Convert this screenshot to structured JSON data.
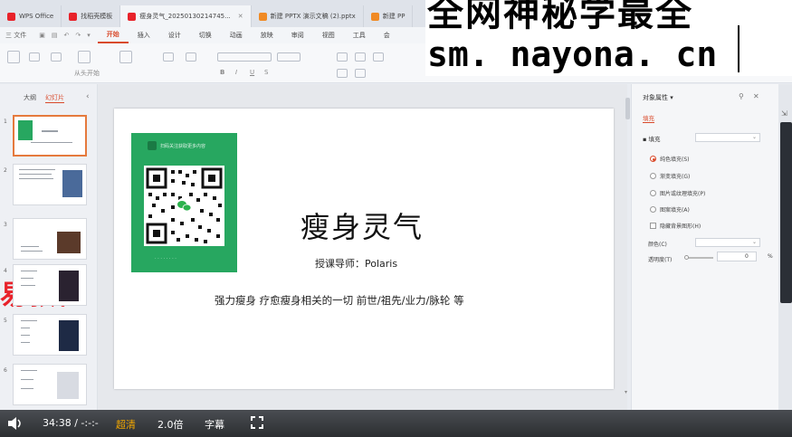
{
  "tabs": [
    {
      "label": "WPS Office",
      "color": "#e8222a"
    },
    {
      "label": "找稻壳模板",
      "color": "#e8222a"
    },
    {
      "label": "瘦身灵气_20250130214745...",
      "color": "#e8222a"
    },
    {
      "label": "新建 PPTX 演示文稿 (2).pptx",
      "color": "#f08a24"
    },
    {
      "label": "新建 PP",
      "color": "#f08a24"
    }
  ],
  "menu": {
    "file": "三 文件",
    "items": [
      "开始",
      "插入",
      "设计",
      "切换",
      "动画",
      "放映",
      "审阅",
      "视图",
      "工具",
      "会"
    ],
    "active": "开始"
  },
  "ribbon": {
    "play_from_start": "从头开始"
  },
  "overlay": {
    "line1": "全网神秘学最全",
    "line2": "sm. nayona. cn"
  },
  "left_panel": {
    "tab_outline": "大纲",
    "tab_slides": "幻灯片",
    "slide_numbers": [
      "1",
      "2",
      "3",
      "4",
      "5",
      "6"
    ],
    "promo_text": "易教程"
  },
  "slide": {
    "qr_caption": "扫码关注获取更多内容",
    "title": "瘦身灵气",
    "teacher": "授课导师：Polaris",
    "description": "强力瘦身 疗愈瘦身相关的一切 前世/祖先/业力/脉轮 等"
  },
  "properties": {
    "title": "对象属性 ▾",
    "tab": "填充",
    "section": "▪ 填充",
    "options": [
      {
        "label": "纯色填充(S)",
        "selected": true
      },
      {
        "label": "渐变填充(G)",
        "selected": false
      },
      {
        "label": "图片或纹理填充(P)",
        "selected": false
      },
      {
        "label": "图案填充(A)",
        "selected": false
      }
    ],
    "hide_bg": "隐藏背景图形(H)",
    "color_label": "颜色(C)",
    "transparency_label": "透明度(T)",
    "transparency_value": "0",
    "transparency_unit": "%"
  },
  "player": {
    "time": "34:38",
    "separator": "/",
    "duration": "-:-:-",
    "quality": "超清",
    "speed": "2.0倍",
    "subtitles": "字幕"
  }
}
